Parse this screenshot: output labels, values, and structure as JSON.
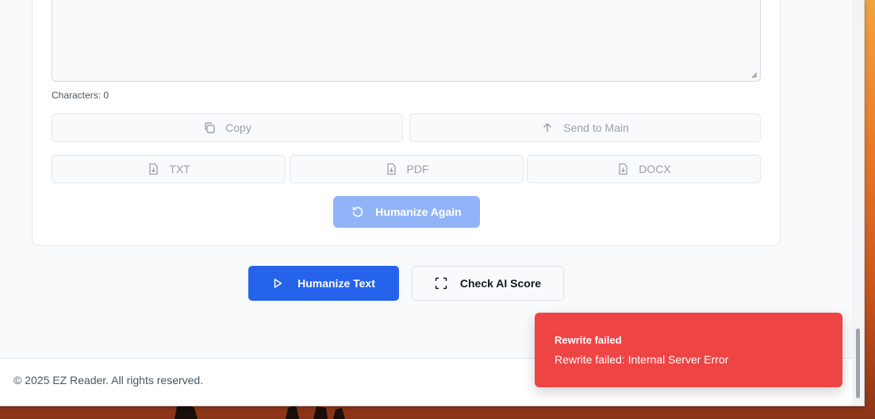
{
  "editor": {
    "char_count": "Characters: 0"
  },
  "actions": {
    "copy": "Copy",
    "send_to_main": "Send to Main"
  },
  "downloads": {
    "txt": "TXT",
    "pdf": "PDF",
    "docx": "DOCX"
  },
  "humanize_again": "Humanize Again",
  "main_actions": {
    "humanize_text": "Humanize Text",
    "check_ai_score": "Check AI Score"
  },
  "footer": {
    "copyright": "© 2025 EZ Reader. All rights reserved."
  },
  "toast": {
    "title": "Rewrite failed",
    "description": "Rewrite failed: Internal Server Error",
    "color": "#ef4444"
  },
  "colors": {
    "primary": "#2563eb",
    "primary_disabled": "#91b4f8"
  },
  "icons": {
    "copy": "copy-icon",
    "send": "arrow-up-icon",
    "file": "file-download-icon",
    "rotate": "rotate-ccw-icon",
    "play": "play-icon",
    "scan": "scan-icon"
  }
}
